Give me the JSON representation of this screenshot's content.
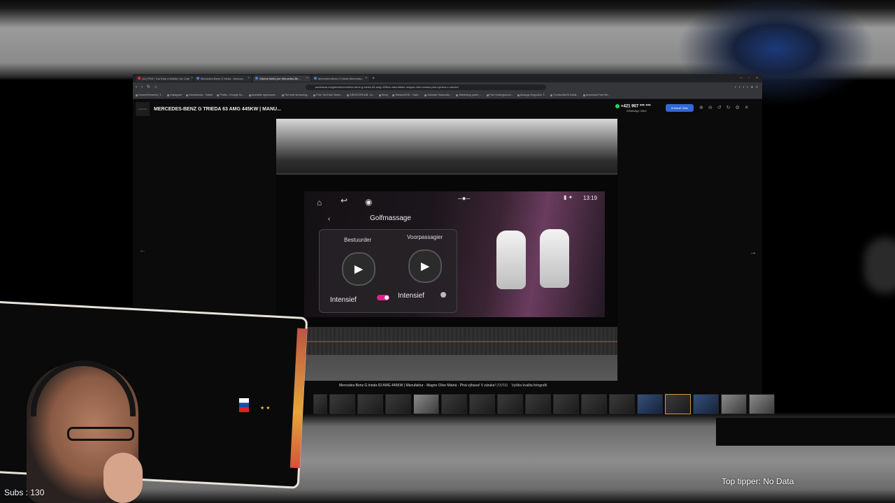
{
  "browser": {
    "tabs": [
      {
        "label": "(11) PDS | YouTube a Mobile Car Club"
      },
      {
        "label": "Mercedes-Benz G trieda - testova..."
      },
      {
        "label": "Galéria fotiek pre Mercedes-Be..."
      },
      {
        "label": "Mercedes-Benz G trieda Mercedes..."
      }
    ],
    "new_tab": "+",
    "url": "autobazar.eu/galeria/mercedes-benz-g-trieda-63-amg-445kw-manufaktur-magno-olive-matna-plna-vybava-v-zaruke/",
    "bookmarks": [
      "DreamElements | T...",
      "Instagram",
      "Inkubátorok - Twitch",
      "Profilo - Escape fro...",
      "Available sponsorsh...",
      "The best streaming...",
      "Free YouTube Video...",
      "CREATORHUB - Ar...",
      "Berry",
      "StreamDISE - Twitc...",
      "Animate Subscribe...",
      "Streaming panel -...",
      "Free Underground...",
      "Abalogo Engo/Anc T...",
      "Tvorba Alertů Začát...",
      "Download Free Bh..."
    ]
  },
  "viewer": {
    "logo": "autobazar",
    "title": "MERCEDES-BENZ G TRIEDA 63 AMG 445KW | MANU...",
    "phone": "+421 907 *** ***",
    "contact_sub": "WhatsApp   Viber",
    "show_button": "Zobraziť číslo",
    "caption": "Mercedes-Benz G trieda 63 AMG 445KW | Manufaktur - Magno Olive Matná - Plná výbava! V záruke!",
    "counter": "(55/58)",
    "hq_link": "Vyššia kvalita fotografií"
  },
  "photo": {
    "time": "13:19",
    "screen_title": "Golfmassage",
    "driver_label": "Bestuurder",
    "passenger_label": "Voorpassagier",
    "driver_mode": "Intensief",
    "passenger_mode": "Intensief",
    "driver_toggle_on": true,
    "passenger_toggle_on": false
  },
  "overlay": {
    "subs": "Subs : 130",
    "tipper": "Top tipper: No Data"
  },
  "colors": {
    "accent": "#3367d6",
    "toggle_on": "#e0218a",
    "whatsapp": "#25d366"
  }
}
